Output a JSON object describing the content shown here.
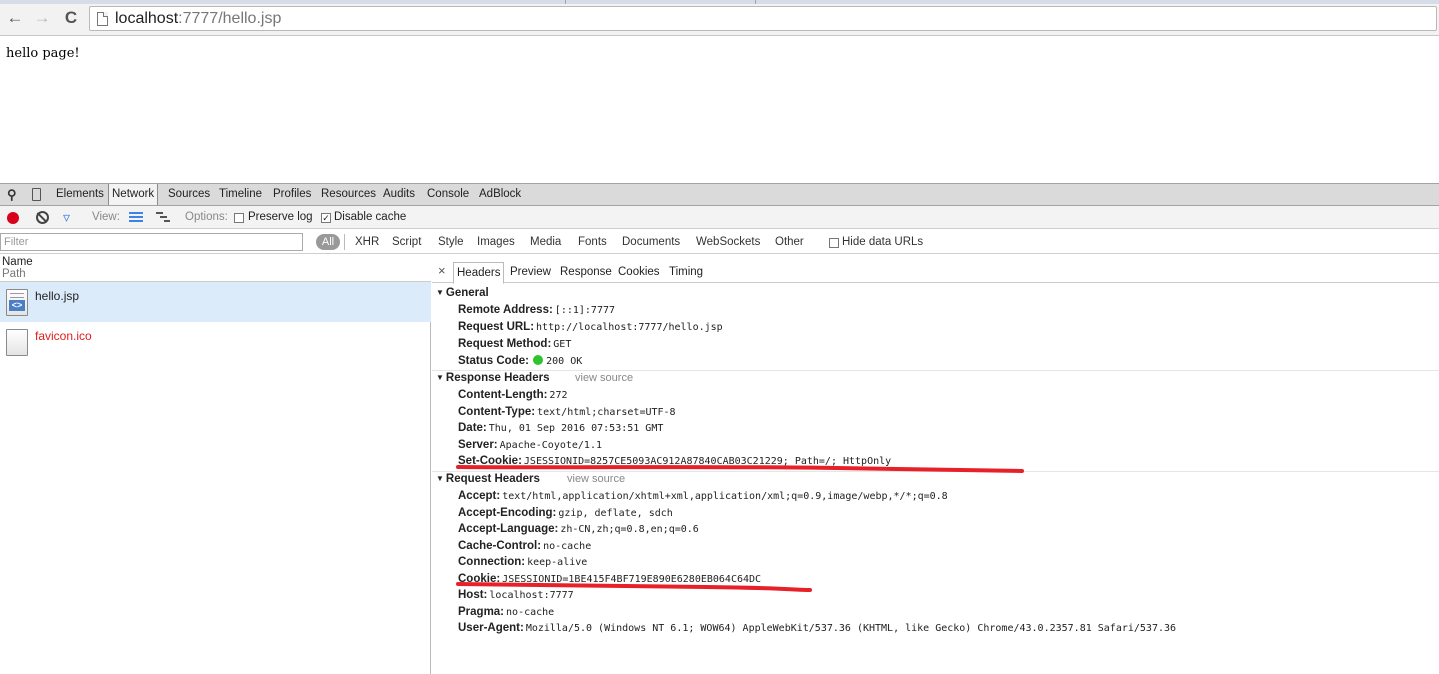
{
  "browser": {
    "url_host": "localhost",
    "url_rest": ":7777/hello.jsp"
  },
  "page": {
    "body_text": "hello page!"
  },
  "devtools": {
    "tabs": [
      "Elements",
      "Network",
      "Sources",
      "Timeline",
      "Profiles",
      "Resources",
      "Audits",
      "Console",
      "AdBlock"
    ],
    "active_tab": "Network",
    "toolbar": {
      "view_label": "View:",
      "options_label": "Options:",
      "preserve_log": "Preserve log",
      "disable_cache": "Disable cache",
      "disable_cache_checked": true,
      "preserve_log_checked": false
    },
    "filter": {
      "placeholder": "Filter",
      "all_label": "All",
      "types": [
        "XHR",
        "Script",
        "Style",
        "Images",
        "Media",
        "Fonts",
        "Documents",
        "WebSockets",
        "Other"
      ],
      "hide_data_urls": "Hide data URLs"
    },
    "list": {
      "col_name": "Name",
      "col_path": "Path",
      "requests": [
        {
          "name": "hello.jsp",
          "selected": true,
          "failed": false
        },
        {
          "name": "favicon.ico",
          "selected": false,
          "failed": true
        }
      ]
    },
    "detail_tabs": [
      "Headers",
      "Preview",
      "Response",
      "Cookies",
      "Timing"
    ],
    "active_detail_tab": "Headers",
    "general": {
      "title": "General",
      "remote_address_k": "Remote Address:",
      "remote_address_v": "[::1]:7777",
      "request_url_k": "Request URL:",
      "request_url_v": "http://localhost:7777/hello.jsp",
      "request_method_k": "Request Method:",
      "request_method_v": "GET",
      "status_code_k": "Status Code:",
      "status_code_v": "200 OK"
    },
    "response_headers": {
      "title": "Response Headers",
      "view_source": "view source",
      "items": [
        {
          "k": "Content-Length:",
          "v": "272"
        },
        {
          "k": "Content-Type:",
          "v": "text/html;charset=UTF-8"
        },
        {
          "k": "Date:",
          "v": "Thu, 01 Sep 2016 07:53:51 GMT"
        },
        {
          "k": "Server:",
          "v": "Apache-Coyote/1.1"
        },
        {
          "k": "Set-Cookie:",
          "v": "JSESSIONID=8257CE5093AC912A87840CAB03C21229; Path=/; HttpOnly"
        }
      ]
    },
    "request_headers": {
      "title": "Request Headers",
      "view_source": "view source",
      "items": [
        {
          "k": "Accept:",
          "v": "text/html,application/xhtml+xml,application/xml;q=0.9,image/webp,*/*;q=0.8"
        },
        {
          "k": "Accept-Encoding:",
          "v": "gzip, deflate, sdch"
        },
        {
          "k": "Accept-Language:",
          "v": "zh-CN,zh;q=0.8,en;q=0.6"
        },
        {
          "k": "Cache-Control:",
          "v": "no-cache"
        },
        {
          "k": "Connection:",
          "v": "keep-alive"
        },
        {
          "k": "Cookie:",
          "v": "JSESSIONID=1BE415F4BF719E890E6280EB064C64DC"
        },
        {
          "k": "Host:",
          "v": "localhost:7777"
        },
        {
          "k": "Pragma:",
          "v": "no-cache"
        },
        {
          "k": "User-Agent:",
          "v": "Mozilla/5.0 (Windows NT 6.1; WOW64) AppleWebKit/537.36 (KHTML, like Gecko) Chrome/43.0.2357.81 Safari/537.36"
        }
      ]
    },
    "colors": {
      "record": "#d9001b",
      "annotation": "#e8202a",
      "status_ok": "#2ec42e",
      "error_text": "#e01b1b",
      "selected_row": "#dcebfa"
    }
  }
}
